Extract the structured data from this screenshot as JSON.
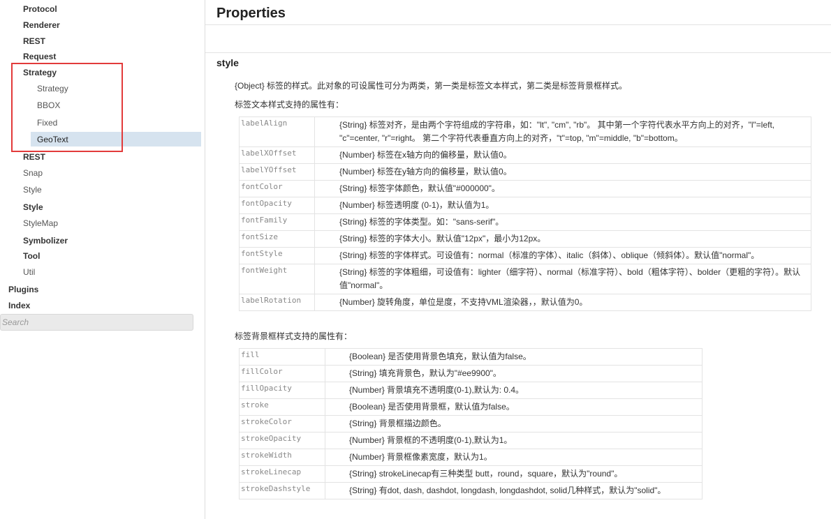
{
  "sidebar": {
    "items": [
      {
        "label": "Protocol"
      },
      {
        "label": "Renderer"
      },
      {
        "label": "REST"
      },
      {
        "label": "Request"
      },
      {
        "label": "Strategy"
      },
      {
        "label": "Strategy"
      },
      {
        "label": "BBOX"
      },
      {
        "label": "Fixed"
      },
      {
        "label": "GeoText",
        "selected": true
      },
      {
        "label": "REST"
      },
      {
        "label": "Snap"
      },
      {
        "label": "Style"
      },
      {
        "label": "Style"
      },
      {
        "label": "StyleMap"
      },
      {
        "label": "Symbolizer"
      },
      {
        "label": "Tool"
      },
      {
        "label": "Util"
      },
      {
        "label": "Plugins"
      },
      {
        "label": "Index"
      }
    ],
    "search_placeholder": "Search"
  },
  "main": {
    "title": "Properties",
    "section_title": "style",
    "intro": "{Object} 标签的样式。此对象的可设属性可分为两类，第一类是标签文本样式，第二类是标签背景框样式。",
    "text_style_heading": "标签文本样式支持的属性有：",
    "text_props": [
      {
        "key": "labelAlign",
        "desc": "{String} 标签对齐，是由两个字符组成的字符串，如：\"lt\", \"cm\", \"rb\"。 其中第一个字符代表水平方向上的对齐，\"l\"=left, \"c\"=center, \"r\"=right。 第二个字符代表垂直方向上的对齐，\"t\"=top, \"m\"=middle, \"b\"=bottom。"
      },
      {
        "key": "labelXOffset",
        "desc": "{Number} 标签在x轴方向的偏移量，默认值0。"
      },
      {
        "key": "labelYOffset",
        "desc": "{Number} 标签在y轴方向的偏移量，默认值0。"
      },
      {
        "key": "fontColor",
        "desc": "{String} 标签字体颜色，默认值\"#000000\"。"
      },
      {
        "key": "fontOpacity",
        "desc": "{Number} 标签透明度 (0-1)，默认值为1。"
      },
      {
        "key": "fontFamily",
        "desc": "{String} 标签的字体类型。如：\"sans-serif\"。"
      },
      {
        "key": "fontSize",
        "desc": "{String} 标签的字体大小。默认值\"12px\"，最小为12px。"
      },
      {
        "key": "fontStyle",
        "desc": "{String} 标签的字体样式。可设值有：normal（标准的字体）、italic（斜体）、oblique（倾斜体）。默认值\"normal\"。"
      },
      {
        "key": "fontWeight",
        "desc": "{String} 标签的字体粗细，可设值有：lighter（细字符）、normal（标准字符）、bold（粗体字符）、bolder（更粗的字符）。默认值\"normal\"。"
      },
      {
        "key": "labelRotation",
        "desc": "{Number} 旋转角度，单位是度，不支持VML渲染器，，默认值为0。"
      }
    ],
    "bg_style_heading": "标签背景框样式支持的属性有：",
    "bg_props": [
      {
        "key": "fill",
        "desc": "{Boolean} 是否使用背景色填充，默认值为false。"
      },
      {
        "key": "fillColor",
        "desc": "{String} 填充背景色，默认为\"#ee9900\"。"
      },
      {
        "key": "fillOpacity",
        "desc": "{Number} 背景填充不透明度(0-1),默认为: 0.4。"
      },
      {
        "key": "stroke",
        "desc": "{Boolean} 是否使用背景框，默认值为false。"
      },
      {
        "key": "strokeColor",
        "desc": "{String} 背景框描边颜色。"
      },
      {
        "key": "strokeOpacity",
        "desc": "{Number} 背景框的不透明度(0-1),默认为1。"
      },
      {
        "key": "strokeWidth",
        "desc": "{Number} 背景框像素宽度，默认为1。"
      },
      {
        "key": "strokeLinecap",
        "desc": "{String} strokeLinecap有三种类型 butt，round，square，默认为\"round\"。"
      },
      {
        "key": "strokeDashstyle",
        "desc": "{String} 有dot, dash, dashdot, longdash, longdashdot, solid几种样式，默认为\"solid\"。"
      }
    ]
  }
}
